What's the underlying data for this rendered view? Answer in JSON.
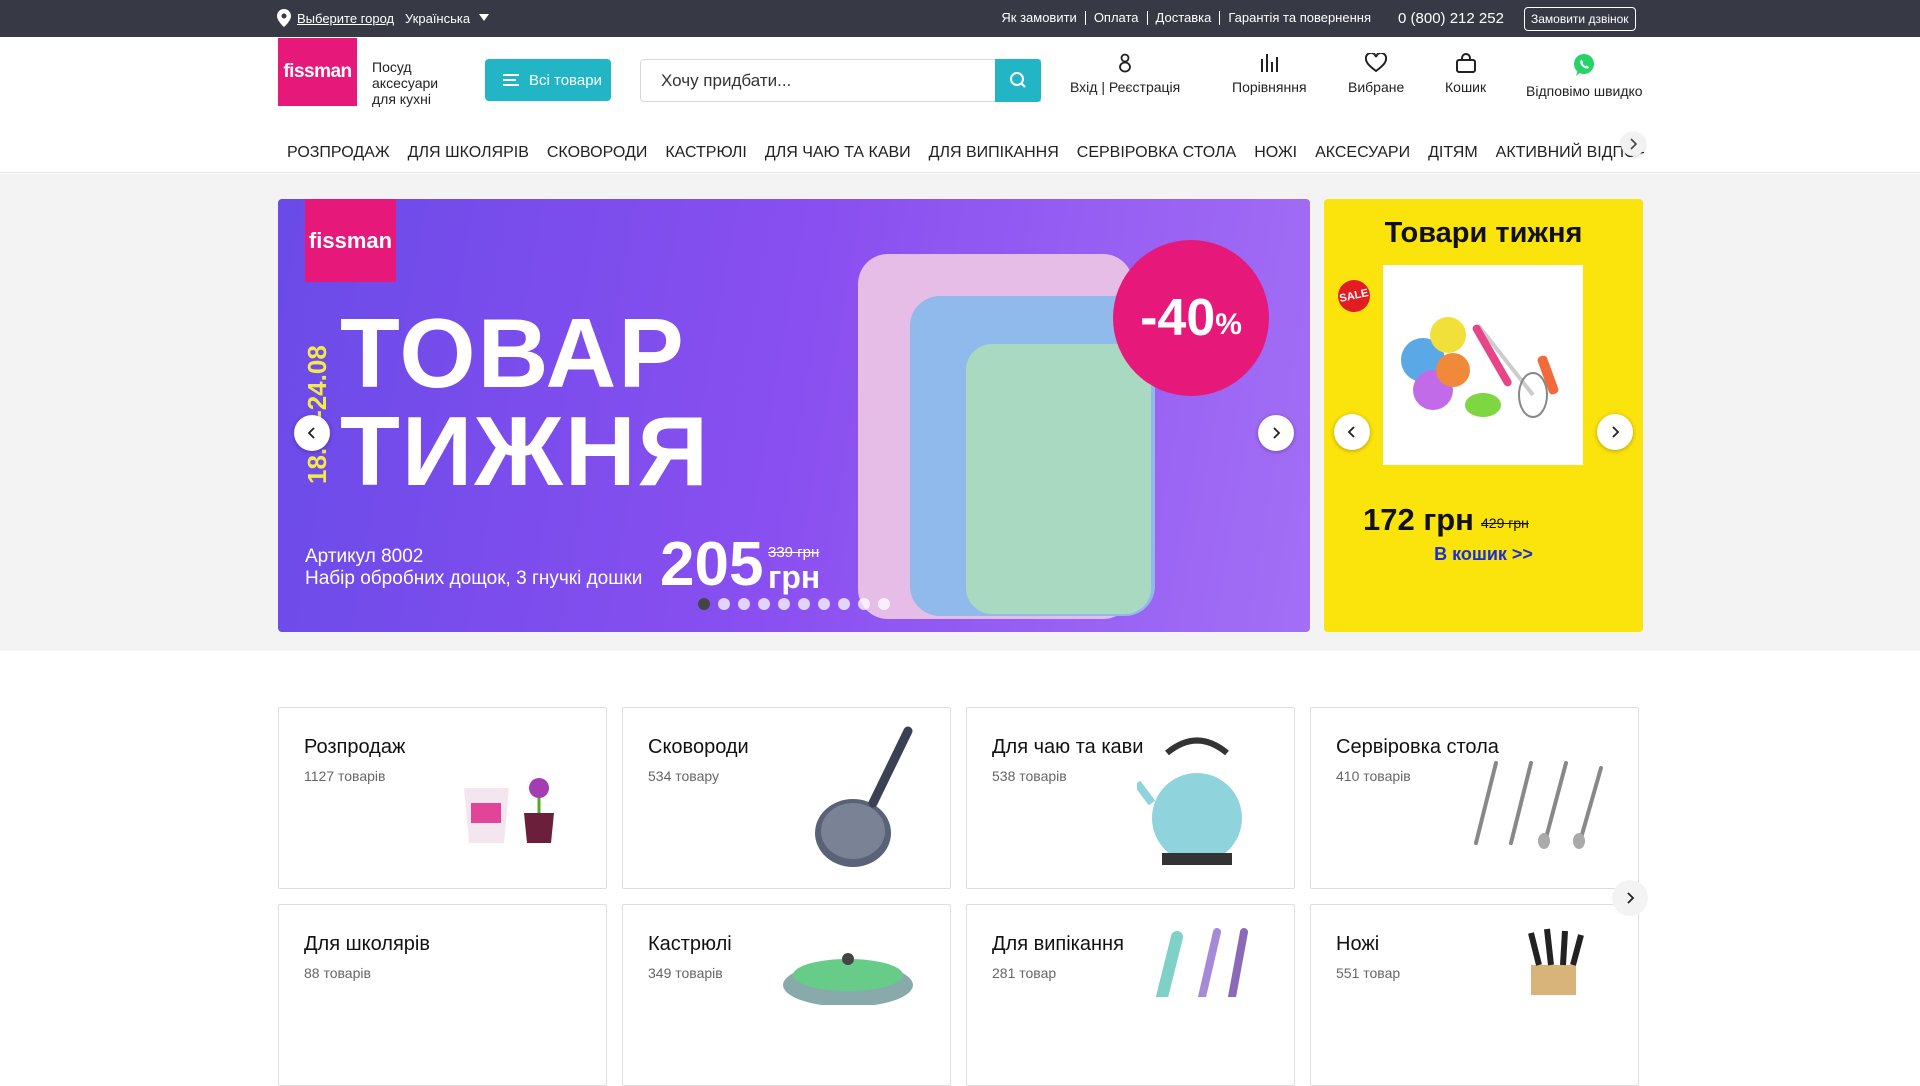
{
  "topbar": {
    "city_link": "Выберите город",
    "language": "Українська",
    "links": [
      "Як замовити",
      "Оплата",
      "Доставка",
      "Гарантія та повернення"
    ],
    "phone": "0 (800) 212 252",
    "callback_button": "Замовити дзвінок"
  },
  "header": {
    "logo": "fissman",
    "tagline": "Посуд аксесуари для кухні",
    "all_products_button": "Всі товари",
    "search_placeholder": "Хочу придбати...",
    "account": "Вхід | Реєстрація",
    "compare": "Порівняння",
    "favorites": "Вибране",
    "cart": "Кошик",
    "whatsapp": "Відповімо швидко"
  },
  "categories_nav": [
    "РОЗПРОДАЖ",
    "ДЛЯ ШКОЛЯРІВ",
    "СКОВОРОДИ",
    "КАСТРЮЛІ",
    "ДЛЯ ЧАЮ ТА КАВИ",
    "ДЛЯ ВИПІКАННЯ",
    "СЕРВІРОВКА СТОЛА",
    "НОЖІ",
    "АКСЕСУАРИ",
    "ДІТЯМ",
    "АКТИВНИЙ ВІДПОЧИНОК"
  ],
  "banner": {
    "logo": "fissman",
    "dates": "18.08-24.08",
    "headline_1": "ТОВАР",
    "headline_2": "ТИЖНЯ",
    "article": "Артикул 8002",
    "description": "Набір обробних дощок, 3 гнучкі дошки",
    "price": "205",
    "old_price": "339 грн",
    "currency": "грн",
    "discount": "-40",
    "discount_unit": "%",
    "slides_total": 10,
    "active_slide": 1
  },
  "week_box": {
    "title": "Товари тижня",
    "sale_badge": "SALE",
    "price": "172 грн",
    "old_price": "429 грн",
    "cart_link": "В кошик >>"
  },
  "category_cards": [
    {
      "title": "Розпродаж",
      "count": "1127 товарів"
    },
    {
      "title": "Сковороди",
      "count": "534 товару"
    },
    {
      "title": "Для чаю та кави",
      "count": "538 товарів"
    },
    {
      "title": "Сервіровка стола",
      "count": "410 товарів"
    },
    {
      "title": "Для школярів",
      "count": "88 товарів"
    },
    {
      "title": "Кастрюлі",
      "count": "349 товарів"
    },
    {
      "title": "Для випікання",
      "count": "281 товар"
    },
    {
      "title": "Ножі",
      "count": "551 товар"
    }
  ],
  "colors": {
    "topbar": "#373a44",
    "brand_pink": "#e6197a",
    "accent_teal": "#21b5c6",
    "week_yellow": "#fbe30c",
    "cart_link_blue": "#1a2fd4"
  }
}
